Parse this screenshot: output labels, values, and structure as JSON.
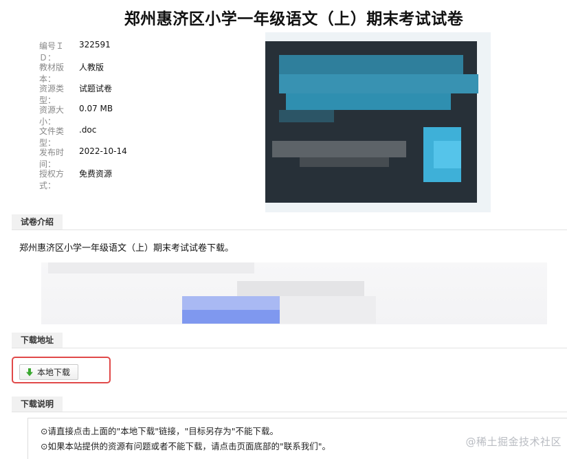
{
  "title": "郑州惠济区小学一年级语文（上）期末考试试卷",
  "meta": [
    {
      "label": "编号ＩＤ：",
      "value": "322591"
    },
    {
      "label": "教材版本：",
      "value": "人教版"
    },
    {
      "label": "资源类型：",
      "value": "试题试卷"
    },
    {
      "label": "资源大小：",
      "value": "0.07 MB"
    },
    {
      "label": "文件类型：",
      "value": ".doc"
    },
    {
      "label": "发布时间：",
      "value": "2022-10-14"
    },
    {
      "label": "授权方式：",
      "value": "免费资源"
    }
  ],
  "sections": {
    "intro": {
      "title": "试卷介绍",
      "text": "郑州惠济区小学一年级语文（上）期末考试试卷下载。"
    },
    "download": {
      "title": "下载地址",
      "button_label": "本地下载"
    },
    "notes": {
      "title": "下载说明",
      "lines": [
        "⊙请直接点击上面的\"本地下载\"链接，\"目标另存为\"不能下载。",
        "⊙如果本站提供的资源有问题或者不能下载，请点击页面底部的\"联系我们\"。"
      ]
    }
  },
  "watermark": "@稀土掘金技术社区",
  "colors": {
    "highlight": "#e04848",
    "download_arrow": "#3aa830",
    "preview_bg": "#273038",
    "preview_accent": "#4ab9dd"
  },
  "icons": {
    "download": "download-arrow-icon"
  }
}
